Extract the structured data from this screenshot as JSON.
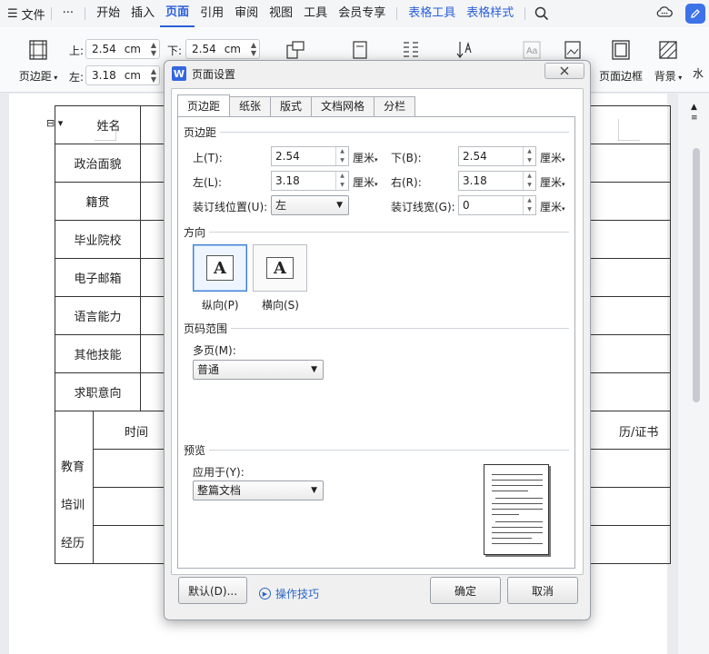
{
  "menubar": {
    "hamburger": "☰",
    "file": "文件",
    "more": "···",
    "tabs": [
      "开始",
      "插入",
      "页面",
      "引用",
      "审阅",
      "视图",
      "工具",
      "会员专享"
    ],
    "active_tab": "页面",
    "context_tabs": [
      "表格工具",
      "表格样式"
    ]
  },
  "ribbon": {
    "margin_btn": "页边距",
    "top_label": "上:",
    "top_value": "2.54",
    "bottom_label": "下:",
    "bottom_value": "2.54",
    "left_label": "左:",
    "left_value": "3.18",
    "unit": "cm",
    "page_border": "页面边框",
    "background": "背景",
    "watermark": "水"
  },
  "resume_rows": [
    "姓名",
    "政治面貌",
    "籍贯",
    "毕业院校",
    "电子邮箱",
    "语言能力",
    "其他技能",
    "求职意向"
  ],
  "resume_edu": {
    "label_lines": [
      "教育",
      "培训",
      "经历"
    ],
    "time": "时间",
    "cert": "历/证书"
  },
  "dialog": {
    "title": "页面设置",
    "tabs": [
      "页边距",
      "纸张",
      "版式",
      "文档网格",
      "分栏"
    ],
    "active_tab": "页边距",
    "margins_section": "页边距",
    "top_label": "上(T):",
    "top_value": "2.54",
    "bottom_label": "下(B):",
    "bottom_value": "2.54",
    "left_label": "左(L):",
    "left_value": "3.18",
    "right_label": "右(R):",
    "right_value": "3.18",
    "unit": "厘米",
    "gutter_pos_label": "装订线位置(U):",
    "gutter_pos_value": "左",
    "gutter_width_label": "装订线宽(G):",
    "gutter_width_value": "0",
    "orientation_section": "方向",
    "portrait": "纵向(P)",
    "landscape": "横向(S)",
    "pages_section": "页码范围",
    "multi_pages_label": "多页(M):",
    "multi_pages_value": "普通",
    "preview_section": "预览",
    "apply_to_label": "应用于(Y):",
    "apply_to_value": "整篇文档",
    "default_btn": "默认(D)...",
    "tips_link": "操作技巧",
    "ok_btn": "确定",
    "cancel_btn": "取消"
  }
}
